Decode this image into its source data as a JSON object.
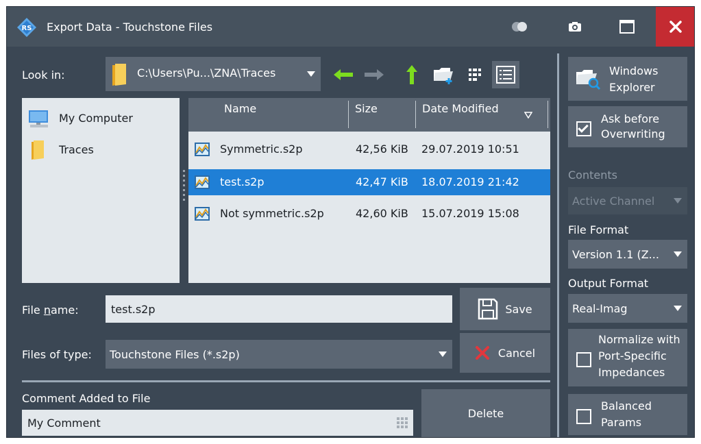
{
  "window": {
    "title": "Export Data - Touchstone Files"
  },
  "lookin": {
    "label": "Look in:",
    "path": "C:\\Users\\Pu...\\ZNA\\Traces"
  },
  "places": [
    {
      "label": "My Computer",
      "icon": "computer-icon"
    },
    {
      "label": "Traces",
      "icon": "folder-icon"
    }
  ],
  "filelist": {
    "columns": [
      "Name",
      "Size",
      "Date Modified"
    ],
    "rows": [
      {
        "name": "Symmetric.s2p",
        "size": "42,56 KiB",
        "date": "29.07.2019 10:51",
        "selected": false
      },
      {
        "name": "test.s2p",
        "size": "42,47 KiB",
        "date": "18.07.2019 21:42",
        "selected": true
      },
      {
        "name": "Not symmetric.s2p",
        "size": "42,60 KiB",
        "date": "15.07.2019 15:08",
        "selected": false
      }
    ]
  },
  "filename": {
    "label_pre": "File ",
    "label_u": "n",
    "label_post": "ame:",
    "value": "test.s2p"
  },
  "filetype": {
    "label": "Files of type:",
    "value": "Touchstone Files (*.s2p)"
  },
  "buttons": {
    "save": "Save",
    "cancel": "Cancel",
    "delete": "Delete"
  },
  "comment": {
    "label": "Comment Added to File",
    "value": "My Comment"
  },
  "right": {
    "windows_explorer_1": "Windows",
    "windows_explorer_2": "Explorer",
    "ask_overwrite_1": "Ask before",
    "ask_overwrite_2": "Overwriting",
    "ask_overwrite_checked": true,
    "contents_label": "Contents",
    "contents_value": "Active Channel",
    "file_format_label": "File Format",
    "file_format_value": "Version 1.1 (Z...",
    "output_format_label": "Output Format",
    "output_format_value": "Real-Imag",
    "normalize_1": "Normalize with",
    "normalize_2": "Port-Specific",
    "normalize_3": "Impedances",
    "normalize_checked": false,
    "balanced_1": "Balanced",
    "balanced_2": "Params",
    "balanced_checked": false
  },
  "colors": {
    "bg": "#3b4754",
    "control": "#5b6673",
    "field": "#e3e8ec",
    "selection": "#1f7fd6",
    "close": "#c42b32",
    "arrow_green": "#7ddc1f"
  }
}
